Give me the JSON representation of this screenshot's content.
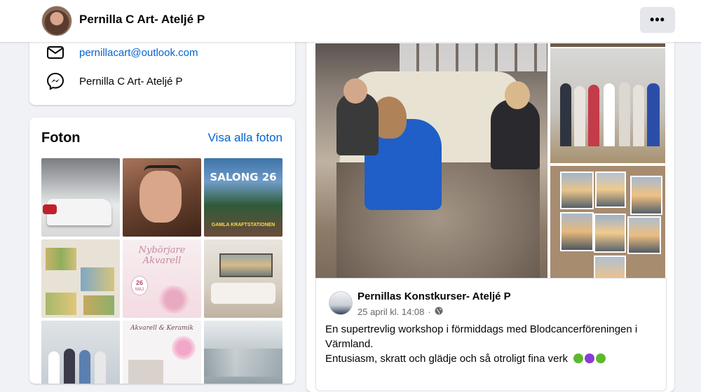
{
  "header": {
    "page_title": "Pernilla C Art- Ateljé P",
    "more_label": "•••"
  },
  "intro": {
    "email": "pernillacart@outlook.com",
    "messenger": "Pernilla C Art- Ateljé P"
  },
  "photos": {
    "title": "Foton",
    "see_all": "Visa alla foton",
    "tile_salong_text": "SALONG 26",
    "tile_salong_sub": "GAMLA KRAFTSTATIONEN",
    "tile_akvarell_title": "Nybörjare Akvarell",
    "tile_akvarell_date_day": "26",
    "tile_akvarell_date_month": "MAJ",
    "tile_keramik_title": "Akvarell & Keramik"
  },
  "post": {
    "page_name": "Pernillas Konstkurser- Ateljé P",
    "date": "25 april kl. 14:08",
    "separator": "·",
    "line1": "En supertrevlig workshop i förmiddags med Blodcancerföreningen i Värmland.",
    "line2": "Entusiasm, skratt och glädje och så otroligt fina verk",
    "colors": {
      "green_heart": "#5cb82e",
      "purple_heart": "#8a3bd8"
    }
  },
  "colors": {
    "accent": "#0064d1",
    "bg": "#f0f2f5"
  }
}
